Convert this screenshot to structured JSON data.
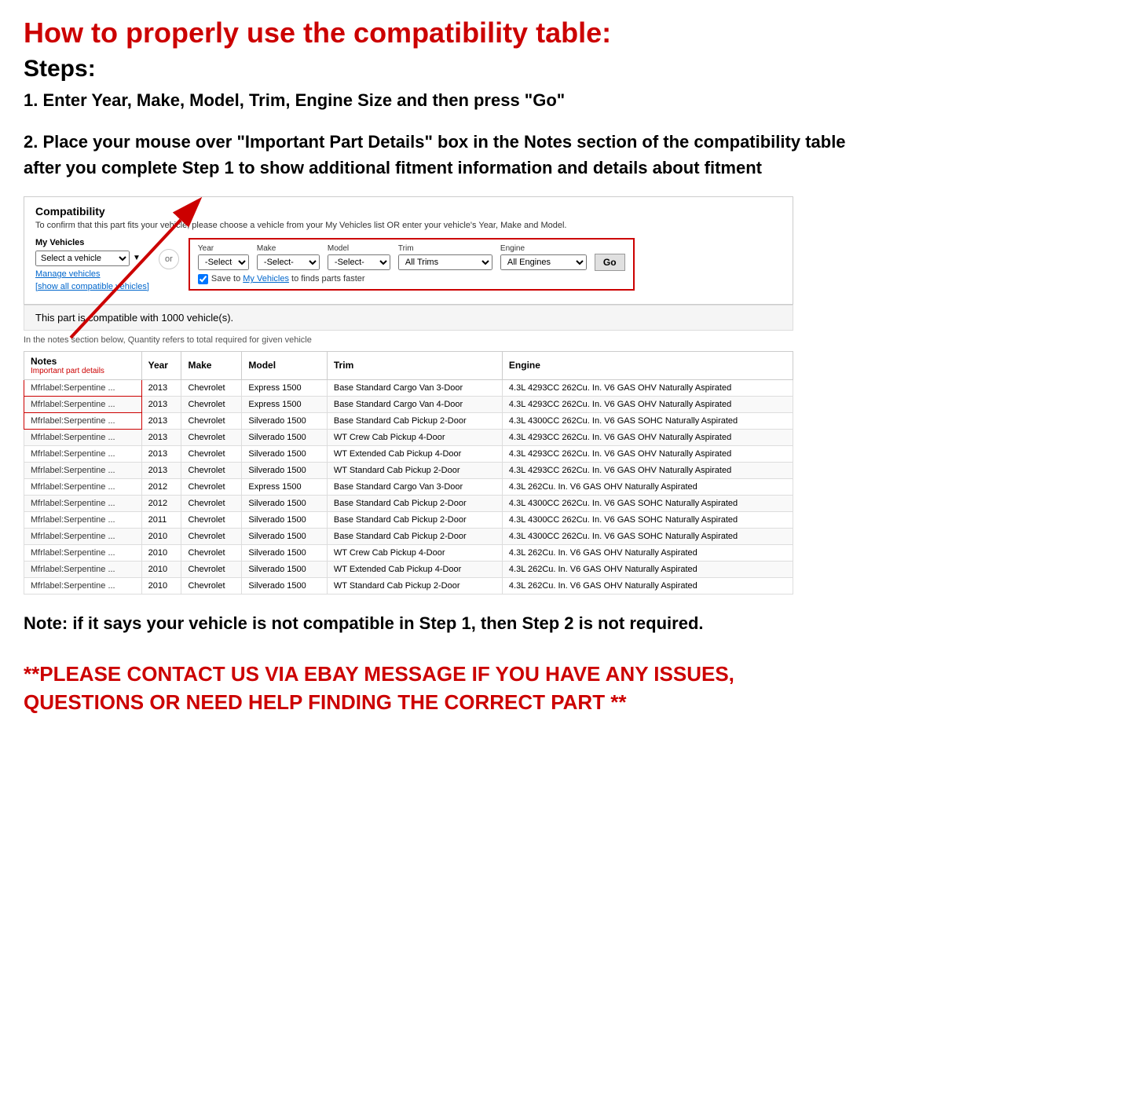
{
  "page": {
    "main_title": "How to properly use the compatibility table:",
    "steps_heading": "Steps:",
    "step1": "1. Enter Year, Make, Model, Trim, Engine Size and then press \"Go\"",
    "step2": "2. Place your mouse over \"Important Part Details\" box in the Notes section of the compatibility table after you complete Step 1 to show additional fitment information and details about fitment",
    "note": "Note: if it says your vehicle is not compatible in Step 1, then Step 2 is not required.",
    "contact": "**PLEASE CONTACT US VIA EBAY MESSAGE IF YOU HAVE ANY ISSUES, QUESTIONS OR NEED HELP FINDING THE CORRECT PART **"
  },
  "compatibility": {
    "title": "Compatibility",
    "subtitle": "To confirm that this part fits your vehicle, please choose a vehicle from your My Vehicles list OR enter your vehicle's Year, Make and Model.",
    "my_vehicles_label": "My Vehicles",
    "select_vehicle_placeholder": "Select a vehicle",
    "manage_vehicles": "Manage vehicles",
    "show_all": "[show all compatible vehicles]",
    "or_label": "or",
    "year_label": "Year",
    "year_value": "-Select-",
    "make_label": "Make",
    "make_value": "-Select-",
    "model_label": "Model",
    "model_value": "-Select-",
    "trim_label": "Trim",
    "trim_value": "All Trims",
    "engine_label": "Engine",
    "engine_value": "All Engines",
    "go_label": "Go",
    "save_text": "Save to My Vehicles to finds parts faster",
    "compat_count_text": "This part is compatible with 1000 vehicle(s).",
    "quantity_note": "In the notes section below, Quantity refers to total required for given vehicle",
    "table": {
      "headers": [
        "Notes",
        "Year",
        "Make",
        "Model",
        "Trim",
        "Engine"
      ],
      "notes_sub": "Important part details",
      "rows": [
        {
          "notes": "Mfrlabel:Serpentine ...",
          "year": "2013",
          "make": "Chevrolet",
          "model": "Express 1500",
          "trim": "Base Standard Cargo Van 3-Door",
          "engine": "4.3L 4293CC 262Cu. In. V6 GAS OHV Naturally Aspirated",
          "highlight": true
        },
        {
          "notes": "Mfrlabel:Serpentine ...",
          "year": "2013",
          "make": "Chevrolet",
          "model": "Express 1500",
          "trim": "Base Standard Cargo Van 4-Door",
          "engine": "4.3L 4293CC 262Cu. In. V6 GAS OHV Naturally Aspirated",
          "highlight": true
        },
        {
          "notes": "Mfrlabel:Serpentine ...",
          "year": "2013",
          "make": "Chevrolet",
          "model": "Silverado 1500",
          "trim": "Base Standard Cab Pickup 2-Door",
          "engine": "4.3L 4300CC 262Cu. In. V6 GAS SOHC Naturally Aspirated",
          "highlight": true
        },
        {
          "notes": "Mfrlabel:Serpentine ...",
          "year": "2013",
          "make": "Chevrolet",
          "model": "Silverado 1500",
          "trim": "WT Crew Cab Pickup 4-Door",
          "engine": "4.3L 4293CC 262Cu. In. V6 GAS OHV Naturally Aspirated",
          "highlight": false
        },
        {
          "notes": "Mfrlabel:Serpentine ...",
          "year": "2013",
          "make": "Chevrolet",
          "model": "Silverado 1500",
          "trim": "WT Extended Cab Pickup 4-Door",
          "engine": "4.3L 4293CC 262Cu. In. V6 GAS OHV Naturally Aspirated",
          "highlight": false
        },
        {
          "notes": "Mfrlabel:Serpentine ...",
          "year": "2013",
          "make": "Chevrolet",
          "model": "Silverado 1500",
          "trim": "WT Standard Cab Pickup 2-Door",
          "engine": "4.3L 4293CC 262Cu. In. V6 GAS OHV Naturally Aspirated",
          "highlight": false
        },
        {
          "notes": "Mfrlabel:Serpentine ...",
          "year": "2012",
          "make": "Chevrolet",
          "model": "Express 1500",
          "trim": "Base Standard Cargo Van 3-Door",
          "engine": "4.3L 262Cu. In. V6 GAS OHV Naturally Aspirated",
          "highlight": false
        },
        {
          "notes": "Mfrlabel:Serpentine ...",
          "year": "2012",
          "make": "Chevrolet",
          "model": "Silverado 1500",
          "trim": "Base Standard Cab Pickup 2-Door",
          "engine": "4.3L 4300CC 262Cu. In. V6 GAS SOHC Naturally Aspirated",
          "highlight": false
        },
        {
          "notes": "Mfrlabel:Serpentine ...",
          "year": "2011",
          "make": "Chevrolet",
          "model": "Silverado 1500",
          "trim": "Base Standard Cab Pickup 2-Door",
          "engine": "4.3L 4300CC 262Cu. In. V6 GAS SOHC Naturally Aspirated",
          "highlight": false
        },
        {
          "notes": "Mfrlabel:Serpentine ...",
          "year": "2010",
          "make": "Chevrolet",
          "model": "Silverado 1500",
          "trim": "Base Standard Cab Pickup 2-Door",
          "engine": "4.3L 4300CC 262Cu. In. V6 GAS SOHC Naturally Aspirated",
          "highlight": false
        },
        {
          "notes": "Mfrlabel:Serpentine ...",
          "year": "2010",
          "make": "Chevrolet",
          "model": "Silverado 1500",
          "trim": "WT Crew Cab Pickup 4-Door",
          "engine": "4.3L 262Cu. In. V6 GAS OHV Naturally Aspirated",
          "highlight": false
        },
        {
          "notes": "Mfrlabel:Serpentine ...",
          "year": "2010",
          "make": "Chevrolet",
          "model": "Silverado 1500",
          "trim": "WT Extended Cab Pickup 4-Door",
          "engine": "4.3L 262Cu. In. V6 GAS OHV Naturally Aspirated",
          "highlight": false
        },
        {
          "notes": "Mfrlabel:Serpentine ...",
          "year": "2010",
          "make": "Chevrolet",
          "model": "Silverado 1500",
          "trim": "WT Standard Cab Pickup 2-Door",
          "engine": "4.3L 262Cu. In. V6 GAS OHV Naturally Aspirated",
          "highlight": false
        }
      ]
    }
  },
  "colors": {
    "red": "#cc0000",
    "link_blue": "#0066cc",
    "border_red": "#cc0000"
  }
}
